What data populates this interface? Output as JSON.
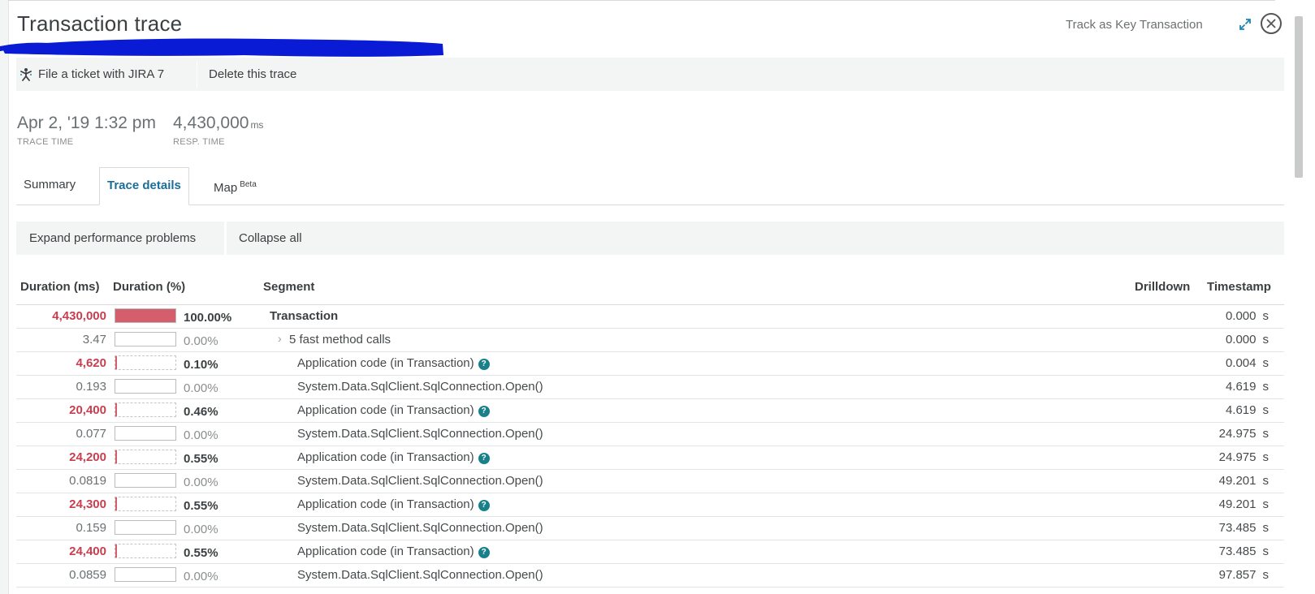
{
  "header": {
    "title": "Transaction trace",
    "key_transaction_link": "Track as Key Transaction"
  },
  "actions": {
    "jira": "File a ticket with JIRA 7",
    "delete": "Delete this trace"
  },
  "stats": {
    "trace_time": {
      "value": "Apr 2, '19 1:32 pm",
      "label": "TRACE TIME"
    },
    "resp_time": {
      "value": "4,430,000",
      "unit": "ms",
      "label": "RESP. TIME"
    }
  },
  "tabs": {
    "summary": "Summary",
    "trace_details": "Trace details",
    "map": "Map",
    "map_badge": "Beta"
  },
  "toolbar": {
    "expand": "Expand performance problems",
    "collapse": "Collapse all"
  },
  "table": {
    "headers": {
      "duration_ms": "Duration (ms)",
      "duration_pct": "Duration (%)",
      "segment": "Segment",
      "drilldown": "Drilldown",
      "timestamp": "Timestamp"
    },
    "rows": [
      {
        "duration": "4,430,000",
        "pct": "100.00%",
        "fill": 1.0,
        "segment": "Transaction",
        "ts": "0.000",
        "unit": "s"
      },
      {
        "duration": "3.47",
        "pct": "0.00%",
        "fill": 0.0,
        "segment": "5 fast method calls",
        "ts": "0.000",
        "unit": "s"
      },
      {
        "duration": "4,620",
        "pct": "0.10%",
        "fill": 0.001,
        "segment": "Application code (in Transaction)",
        "ts": "0.004",
        "unit": "s"
      },
      {
        "duration": "0.193",
        "pct": "0.00%",
        "fill": 0.0,
        "segment": "System.Data.SqlClient.SqlConnection.Open()",
        "ts": "4.619",
        "unit": "s"
      },
      {
        "duration": "20,400",
        "pct": "0.46%",
        "fill": 0.0046,
        "segment": "Application code (in Transaction)",
        "ts": "4.619",
        "unit": "s"
      },
      {
        "duration": "0.077",
        "pct": "0.00%",
        "fill": 0.0,
        "segment": "System.Data.SqlClient.SqlConnection.Open()",
        "ts": "24.975",
        "unit": "s"
      },
      {
        "duration": "24,200",
        "pct": "0.55%",
        "fill": 0.0055,
        "segment": "Application code (in Transaction)",
        "ts": "24.975",
        "unit": "s"
      },
      {
        "duration": "0.0819",
        "pct": "0.00%",
        "fill": 0.0,
        "segment": "System.Data.SqlClient.SqlConnection.Open()",
        "ts": "49.201",
        "unit": "s"
      },
      {
        "duration": "24,300",
        "pct": "0.55%",
        "fill": 0.0055,
        "segment": "Application code (in Transaction)",
        "ts": "49.201",
        "unit": "s"
      },
      {
        "duration": "0.159",
        "pct": "0.00%",
        "fill": 0.0,
        "segment": "System.Data.SqlClient.SqlConnection.Open()",
        "ts": "73.485",
        "unit": "s"
      },
      {
        "duration": "24,400",
        "pct": "0.55%",
        "fill": 0.0055,
        "segment": "Application code (in Transaction)",
        "ts": "73.485",
        "unit": "s"
      },
      {
        "duration": "0.0859",
        "pct": "0.00%",
        "fill": 0.0,
        "segment": "System.Data.SqlClient.SqlConnection.Open()",
        "ts": "97.857",
        "unit": "s"
      }
    ]
  },
  "colors": {
    "hot_value": "#c73f4f",
    "bar_fill": "#d55e6d",
    "active_tab": "#1b6d99",
    "help_icon": "#17808a",
    "redaction": "#0a1bd6"
  }
}
